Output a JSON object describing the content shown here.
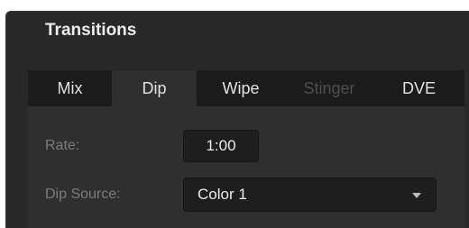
{
  "panel": {
    "title": "Transitions"
  },
  "tabs": [
    {
      "label": "Mix",
      "selected": false,
      "enabled": true
    },
    {
      "label": "Dip",
      "selected": true,
      "enabled": true
    },
    {
      "label": "Wipe",
      "selected": false,
      "enabled": true
    },
    {
      "label": "Stinger",
      "selected": false,
      "enabled": false
    },
    {
      "label": "DVE",
      "selected": false,
      "enabled": true
    }
  ],
  "dip": {
    "rate_label": "Rate:",
    "rate_value": "1:00",
    "source_label": "Dip Source:",
    "source_value": "Color 1"
  },
  "icons": {
    "dropdown": "chevron-down-icon"
  }
}
